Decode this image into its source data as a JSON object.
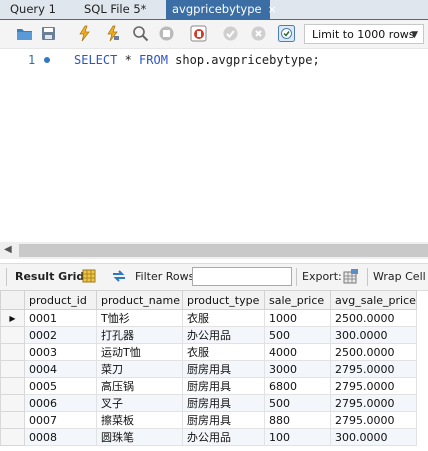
{
  "tabs": [
    {
      "label": "Query 1",
      "active": false
    },
    {
      "label": "SQL File 5*",
      "active": false
    },
    {
      "label": "avgpricebytype",
      "active": true,
      "close": "×"
    }
  ],
  "toolbar": {
    "limit_select": "Limit to 1000 rows"
  },
  "editor": {
    "line_number": "1",
    "keyword_select": "SELECT",
    "star": " * ",
    "keyword_from": "FROM",
    "table_ref": " shop.avgpricebytype;"
  },
  "result_toolbar": {
    "result_grid": "Result Grid",
    "filter_rows": "Filter Rows:",
    "export": "Export:",
    "wrap_cell": "Wrap Cell C"
  },
  "grid": {
    "columns": [
      "product_id",
      "product_name",
      "product_type",
      "sale_price",
      "avg_sale_price"
    ],
    "rows": [
      [
        "0001",
        "T恤衫",
        "衣服",
        "1000",
        "2500.0000"
      ],
      [
        "0002",
        "打孔器",
        "办公用品",
        "500",
        "300.0000"
      ],
      [
        "0003",
        "运动T恤",
        "衣服",
        "4000",
        "2500.0000"
      ],
      [
        "0004",
        "菜刀",
        "厨房用具",
        "3000",
        "2795.0000"
      ],
      [
        "0005",
        "高压锅",
        "厨房用具",
        "6800",
        "2795.0000"
      ],
      [
        "0006",
        "叉子",
        "厨房用具",
        "500",
        "2795.0000"
      ],
      [
        "0007",
        "擦菜板",
        "厨房用具",
        "880",
        "2795.0000"
      ],
      [
        "0008",
        "圆珠笔",
        "办公用品",
        "100",
        "300.0000"
      ]
    ]
  },
  "colors": {
    "active_tab": "#3a6ea5",
    "keyword": "#2a55c8",
    "alt_row": "#f3f6fb"
  },
  "icons": [
    "folder-open-icon",
    "save-icon",
    "execute-icon",
    "execute-current-icon",
    "explain-icon",
    "stop-icon",
    "toggle-continue-on-error-icon",
    "commit-icon",
    "rollback-icon",
    "autocommit-icon",
    "grid-icon",
    "refresh-icon",
    "export-icon"
  ]
}
